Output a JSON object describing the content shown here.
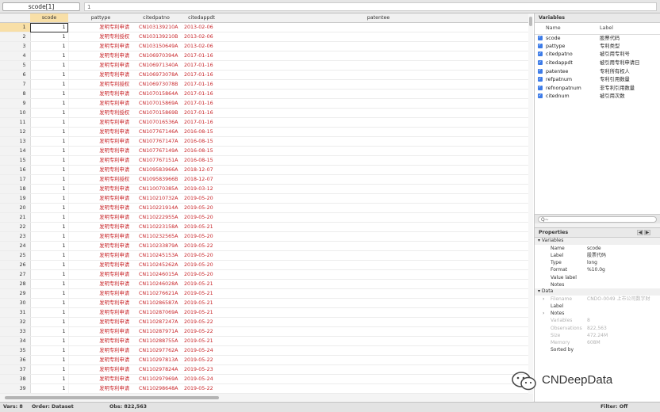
{
  "toolbar": {
    "cell_ref": "scode[1]",
    "cell_value": "1"
  },
  "columns": [
    "scode",
    "pattype",
    "citedpatno",
    "citedappdt",
    "patentee"
  ],
  "rows": [
    {
      "n": "1",
      "scode": "1",
      "pattype": "发明专利申请",
      "citedpatno": "CN103139210A",
      "citedappdt": "2013-02-06"
    },
    {
      "n": "2",
      "scode": "1",
      "pattype": "发明专利授权",
      "citedpatno": "CN103139210B",
      "citedappdt": "2013-02-06"
    },
    {
      "n": "3",
      "scode": "1",
      "pattype": "发明专利申请",
      "citedpatno": "CN103150649A",
      "citedappdt": "2013-02-06"
    },
    {
      "n": "4",
      "scode": "1",
      "pattype": "发明专利申请",
      "citedpatno": "CN106970394A",
      "citedappdt": "2017-01-16"
    },
    {
      "n": "5",
      "scode": "1",
      "pattype": "发明专利申请",
      "citedpatno": "CN106971340A",
      "citedappdt": "2017-01-16"
    },
    {
      "n": "6",
      "scode": "1",
      "pattype": "发明专利申请",
      "citedpatno": "CN106973078A",
      "citedappdt": "2017-01-16"
    },
    {
      "n": "7",
      "scode": "1",
      "pattype": "发明专利授权",
      "citedpatno": "CN106973078B",
      "citedappdt": "2017-01-16"
    },
    {
      "n": "8",
      "scode": "1",
      "pattype": "发明专利申请",
      "citedpatno": "CN107015864A",
      "citedappdt": "2017-01-16"
    },
    {
      "n": "9",
      "scode": "1",
      "pattype": "发明专利申请",
      "citedpatno": "CN107015869A",
      "citedappdt": "2017-01-16"
    },
    {
      "n": "10",
      "scode": "1",
      "pattype": "发明专利授权",
      "citedpatno": "CN107015869B",
      "citedappdt": "2017-01-16"
    },
    {
      "n": "11",
      "scode": "1",
      "pattype": "发明专利申请",
      "citedpatno": "CN107016536A",
      "citedappdt": "2017-01-16"
    },
    {
      "n": "12",
      "scode": "1",
      "pattype": "发明专利申请",
      "citedpatno": "CN107767146A",
      "citedappdt": "2016-08-15"
    },
    {
      "n": "13",
      "scode": "1",
      "pattype": "发明专利申请",
      "citedpatno": "CN107767147A",
      "citedappdt": "2016-08-15"
    },
    {
      "n": "14",
      "scode": "1",
      "pattype": "发明专利申请",
      "citedpatno": "CN107767149A",
      "citedappdt": "2016-08-15"
    },
    {
      "n": "15",
      "scode": "1",
      "pattype": "发明专利申请",
      "citedpatno": "CN107767151A",
      "citedappdt": "2016-08-15"
    },
    {
      "n": "16",
      "scode": "1",
      "pattype": "发明专利申请",
      "citedpatno": "CN109583966A",
      "citedappdt": "2018-12-07"
    },
    {
      "n": "17",
      "scode": "1",
      "pattype": "发明专利授权",
      "citedpatno": "CN109583966B",
      "citedappdt": "2018-12-07"
    },
    {
      "n": "18",
      "scode": "1",
      "pattype": "发明专利申请",
      "citedpatno": "CN110070385A",
      "citedappdt": "2019-03-12"
    },
    {
      "n": "19",
      "scode": "1",
      "pattype": "发明专利申请",
      "citedpatno": "CN110210732A",
      "citedappdt": "2019-05-20"
    },
    {
      "n": "20",
      "scode": "1",
      "pattype": "发明专利申请",
      "citedpatno": "CN110221914A",
      "citedappdt": "2019-05-20"
    },
    {
      "n": "21",
      "scode": "1",
      "pattype": "发明专利申请",
      "citedpatno": "CN110222955A",
      "citedappdt": "2019-05-20"
    },
    {
      "n": "22",
      "scode": "1",
      "pattype": "发明专利申请",
      "citedpatno": "CN110223158A",
      "citedappdt": "2019-05-21"
    },
    {
      "n": "23",
      "scode": "1",
      "pattype": "发明专利申请",
      "citedpatno": "CN110232565A",
      "citedappdt": "2019-05-20"
    },
    {
      "n": "24",
      "scode": "1",
      "pattype": "发明专利申请",
      "citedpatno": "CN110233879A",
      "citedappdt": "2019-05-22"
    },
    {
      "n": "25",
      "scode": "1",
      "pattype": "发明专利申请",
      "citedpatno": "CN110245153A",
      "citedappdt": "2019-05-20"
    },
    {
      "n": "26",
      "scode": "1",
      "pattype": "发明专利申请",
      "citedpatno": "CN110245262A",
      "citedappdt": "2019-05-20"
    },
    {
      "n": "27",
      "scode": "1",
      "pattype": "发明专利申请",
      "citedpatno": "CN110246015A",
      "citedappdt": "2019-05-20"
    },
    {
      "n": "28",
      "scode": "1",
      "pattype": "发明专利申请",
      "citedpatno": "CN110246028A",
      "citedappdt": "2019-05-21"
    },
    {
      "n": "29",
      "scode": "1",
      "pattype": "发明专利申请",
      "citedpatno": "CN110276621A",
      "citedappdt": "2019-05-21"
    },
    {
      "n": "30",
      "scode": "1",
      "pattype": "发明专利申请",
      "citedpatno": "CN110286587A",
      "citedappdt": "2019-05-21"
    },
    {
      "n": "31",
      "scode": "1",
      "pattype": "发明专利申请",
      "citedpatno": "CN110287069A",
      "citedappdt": "2019-05-21"
    },
    {
      "n": "32",
      "scode": "1",
      "pattype": "发明专利申请",
      "citedpatno": "CN110287247A",
      "citedappdt": "2019-05-22"
    },
    {
      "n": "33",
      "scode": "1",
      "pattype": "发明专利申请",
      "citedpatno": "CN110287971A",
      "citedappdt": "2019-05-22"
    },
    {
      "n": "34",
      "scode": "1",
      "pattype": "发明专利申请",
      "citedpatno": "CN110288755A",
      "citedappdt": "2019-05-21"
    },
    {
      "n": "35",
      "scode": "1",
      "pattype": "发明专利申请",
      "citedpatno": "CN110297762A",
      "citedappdt": "2019-05-24"
    },
    {
      "n": "36",
      "scode": "1",
      "pattype": "发明专利申请",
      "citedpatno": "CN110297813A",
      "citedappdt": "2019-05-22"
    },
    {
      "n": "37",
      "scode": "1",
      "pattype": "发明专利申请",
      "citedpatno": "CN110297824A",
      "citedappdt": "2019-05-23"
    },
    {
      "n": "38",
      "scode": "1",
      "pattype": "发明专利申请",
      "citedpatno": "CN110297969A",
      "citedappdt": "2019-05-24"
    },
    {
      "n": "39",
      "scode": "1",
      "pattype": "发明专利申请",
      "citedpatno": "CN110298648A",
      "citedappdt": "2019-05-22"
    }
  ],
  "variables_panel": {
    "title": "Variables",
    "col_name": "Name",
    "col_label": "Label",
    "items": [
      {
        "name": "scode",
        "label": "股票代码"
      },
      {
        "name": "pattype",
        "label": "专利类型"
      },
      {
        "name": "citedpatno",
        "label": "被引用专利号"
      },
      {
        "name": "citedappdt",
        "label": "被引用专利申请日"
      },
      {
        "name": "patentee",
        "label": "专利所有权人"
      },
      {
        "name": "refpatnum",
        "label": "专利引用数量"
      },
      {
        "name": "refnonpatnum",
        "label": "非专利引用数量"
      },
      {
        "name": "citednum",
        "label": "被引用次数"
      }
    ],
    "search_placeholder": "Q~"
  },
  "properties_panel": {
    "title": "Properties",
    "variables_section": "Variables",
    "var_rows": [
      {
        "k": "Name",
        "v": "scode"
      },
      {
        "k": "Label",
        "v": "股票代码"
      },
      {
        "k": "Type",
        "v": "long"
      },
      {
        "k": "Format",
        "v": "%10.0g"
      },
      {
        "k": "Value label",
        "v": ""
      },
      {
        "k": "Notes",
        "v": ""
      }
    ],
    "data_section": "Data",
    "data_rows": [
      {
        "k": "Filename",
        "v": "CNDO-0049 上市公司数字财",
        "gray": true
      },
      {
        "k": "Label",
        "v": "",
        "gray": false
      },
      {
        "k": "Notes",
        "v": "",
        "gray": false
      },
      {
        "k": "Variables",
        "v": "8",
        "gray": true
      },
      {
        "k": "Observations",
        "v": "822,563",
        "gray": true
      },
      {
        "k": "Size",
        "v": "472.24M",
        "gray": true
      },
      {
        "k": "Memory",
        "v": "608M",
        "gray": true
      },
      {
        "k": "Sorted by",
        "v": "",
        "gray": false
      }
    ]
  },
  "status": {
    "vars": "Vars: 8",
    "order": "Order: Dataset",
    "obs": "Obs: 822,563",
    "filter": "Filter: Off"
  },
  "watermark": {
    "text": "CNDeepData"
  }
}
